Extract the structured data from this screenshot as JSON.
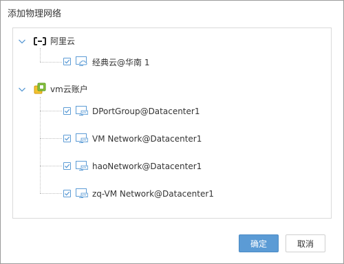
{
  "dialog": {
    "title": "添加物理网络",
    "confirm_label": "确定",
    "cancel_label": "取消"
  },
  "tree": {
    "providers": [
      {
        "name": "阿里云",
        "icon": "aliyun-logo-icon",
        "expanded": true,
        "networks": [
          {
            "label": "经典云@华南 1",
            "icon": "cloud-network-icon",
            "checked": true
          }
        ]
      },
      {
        "name": "vm云账户",
        "icon": "vmware-logo-icon",
        "expanded": true,
        "networks": [
          {
            "label": "DPortGroup@Datacenter1",
            "icon": "vpc-icon",
            "checked": true
          },
          {
            "label": "VM Network@Datacenter1",
            "icon": "vpc-icon",
            "checked": true
          },
          {
            "label": "haoNetwork@Datacenter1",
            "icon": "vpc-icon",
            "checked": true
          },
          {
            "label": "zq-VM Network@Datacenter1",
            "icon": "vpc-icon",
            "checked": true
          }
        ]
      }
    ]
  },
  "colors": {
    "primary": "#5b9bd5",
    "icon_blue": "#5b9bd5",
    "vmware_yellow": "#8cc63f"
  }
}
